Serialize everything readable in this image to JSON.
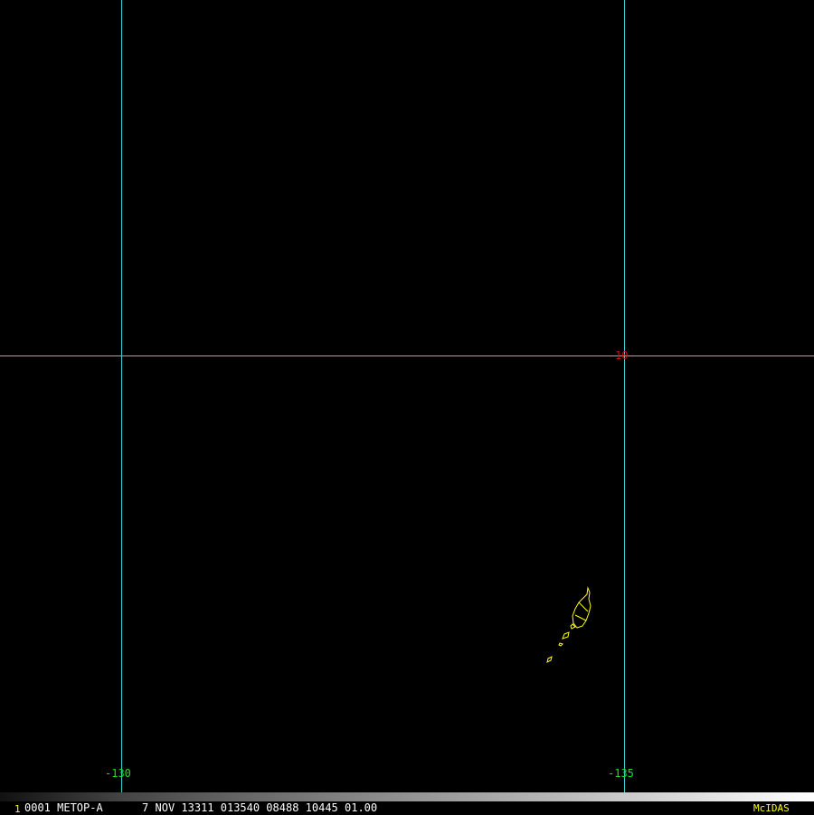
{
  "map": {
    "background": "#000000",
    "grid_color": "#40d0d0",
    "coast_color": "#ffff00",
    "longitude_labels": [
      "-130",
      "-135"
    ],
    "latitude_labels": [
      "10"
    ],
    "lon_label_color": "#22dd22",
    "lat_label_color": "#cc1111"
  },
  "status_bar": {
    "frame_number": "1",
    "text": "0001 METOP-A      7 NOV 13311 013540 08488 10445 01.00",
    "brand": "McIDAS",
    "brand_color": "#ffff00"
  }
}
